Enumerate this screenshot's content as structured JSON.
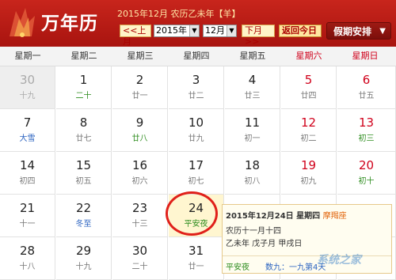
{
  "header": {
    "title": "万年历",
    "info": "2015年12月 农历乙未年【羊】",
    "prev_month": "<<上月",
    "year_value": "2015年",
    "month_value": "12月",
    "next_month": "下月>>",
    "back_today": "返回今日",
    "holiday": "假期安排",
    "dropdown_arrow": "▼"
  },
  "weekdays": [
    "星期一",
    "星期二",
    "星期三",
    "星期四",
    "星期五",
    "星期六",
    "星期日"
  ],
  "weeks": [
    [
      {
        "d": "30",
        "l": "十九"
      },
      {
        "d": "1",
        "l": "二十"
      },
      {
        "d": "2",
        "l": "廿一"
      },
      {
        "d": "3",
        "l": "廿二"
      },
      {
        "d": "4",
        "l": "廿三"
      },
      {
        "d": "5",
        "l": "廿四"
      },
      {
        "d": "6",
        "l": "廿五"
      }
    ],
    [
      {
        "d": "7",
        "l": "大雪"
      },
      {
        "d": "8",
        "l": "廿七"
      },
      {
        "d": "9",
        "l": "廿八"
      },
      {
        "d": "10",
        "l": "廿九"
      },
      {
        "d": "11",
        "l": "初一"
      },
      {
        "d": "12",
        "l": "初二"
      },
      {
        "d": "13",
        "l": "初三"
      }
    ],
    [
      {
        "d": "14",
        "l": "初四"
      },
      {
        "d": "15",
        "l": "初五"
      },
      {
        "d": "16",
        "l": "初六"
      },
      {
        "d": "17",
        "l": "初七"
      },
      {
        "d": "18",
        "l": "初八"
      },
      {
        "d": "19",
        "l": "初九"
      },
      {
        "d": "20",
        "l": "初十"
      }
    ],
    [
      {
        "d": "21",
        "l": "十一"
      },
      {
        "d": "22",
        "l": "冬至"
      },
      {
        "d": "23",
        "l": "十三"
      },
      {
        "d": "24",
        "l": "平安夜"
      },
      {
        "d": "",
        "l": ""
      },
      {
        "d": "",
        "l": ""
      },
      {
        "d": "",
        "l": ""
      }
    ],
    [
      {
        "d": "28",
        "l": "十八"
      },
      {
        "d": "29",
        "l": "十九"
      },
      {
        "d": "30",
        "l": "二十"
      },
      {
        "d": "31",
        "l": "廿一"
      },
      {
        "d": "",
        "l": ""
      },
      {
        "d": "",
        "l": ""
      },
      {
        "d": "",
        "l": ""
      }
    ]
  ],
  "popup": {
    "date": "2015年12月24日  星期四",
    "zodiac": "摩羯座",
    "lunar": "农历十一月十四",
    "ganzhi": "乙未年 戊子月 甲戌日",
    "festival": "平安夜",
    "jiu": "数九：一九第4天"
  },
  "watermark": "系统之家"
}
